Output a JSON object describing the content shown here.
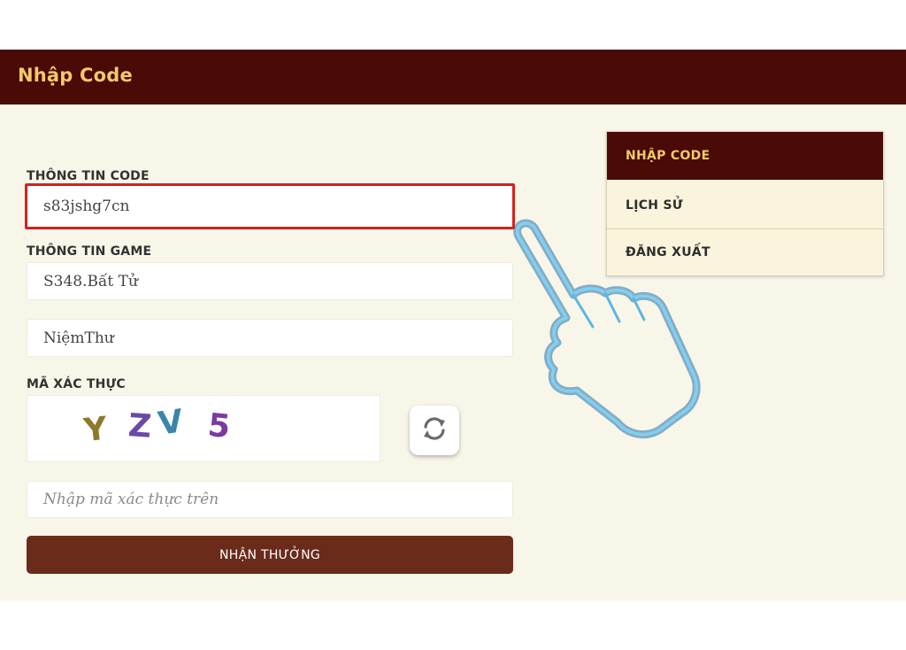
{
  "header": {
    "title": "Nhập Code"
  },
  "form": {
    "code_label": "THÔNG TIN CODE",
    "code_value": "s83jshg7cn",
    "game_label": "THÔNG TIN GAME",
    "server_value": "S348.Bất Tử",
    "character_value": "NiệmThư",
    "captcha_label": "MÃ XÁC THỰC",
    "captcha_chars": [
      "Y",
      "Z",
      "V",
      "5"
    ],
    "captcha_placeholder": "Nhập mã xác thực trên",
    "submit_label": "NHẬN THƯỞNG"
  },
  "menu": {
    "items": [
      {
        "label": "NHẬP CODE",
        "active": true
      },
      {
        "label": "LỊCH SỬ",
        "active": false
      },
      {
        "label": "ĐĂNG XUẤT",
        "active": false
      }
    ]
  },
  "icons": {
    "refresh": "refresh-icon",
    "pointer": "pointing-hand-icon"
  },
  "colors": {
    "header_bg": "#4a0a06",
    "header_text": "#f2c96b",
    "panel_bg": "#f7f6e8",
    "button_bg": "#6b2b1a",
    "highlight_border": "#d8201c",
    "menu_bg": "#fbf4dc",
    "hand_stroke": "#4aa3d8"
  }
}
